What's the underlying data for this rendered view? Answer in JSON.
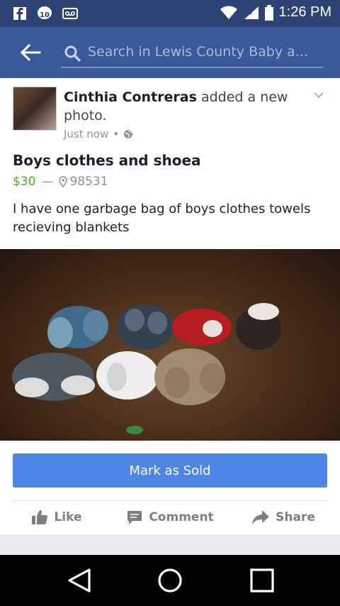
{
  "status_bar": {
    "time": "1:26 PM",
    "left_icons": [
      "facebook-icon",
      "messenger-icon",
      "voicemail-icon"
    ],
    "right_icons": [
      "wifi-icon",
      "signal-icon",
      "battery-icon"
    ]
  },
  "app_bar": {
    "search_placeholder": "Search in Lewis County Baby a...",
    "color": "#3b5998"
  },
  "post": {
    "author": "Cinthia Contreras",
    "action": "added a new photo.",
    "timestamp": "Just now",
    "title": "Boys clothes and shoea",
    "price": "$30",
    "separator": "—",
    "zip": "98531",
    "description": "I have one garbage bag of boys clothes towels recieving blankets",
    "mark_sold_label": "Mark as Sold",
    "actions": {
      "like": "Like",
      "comment": "Comment",
      "share": "Share"
    }
  },
  "colors": {
    "price": "#42b72a",
    "button": "#4e86e6",
    "brand": "#3b5998"
  }
}
